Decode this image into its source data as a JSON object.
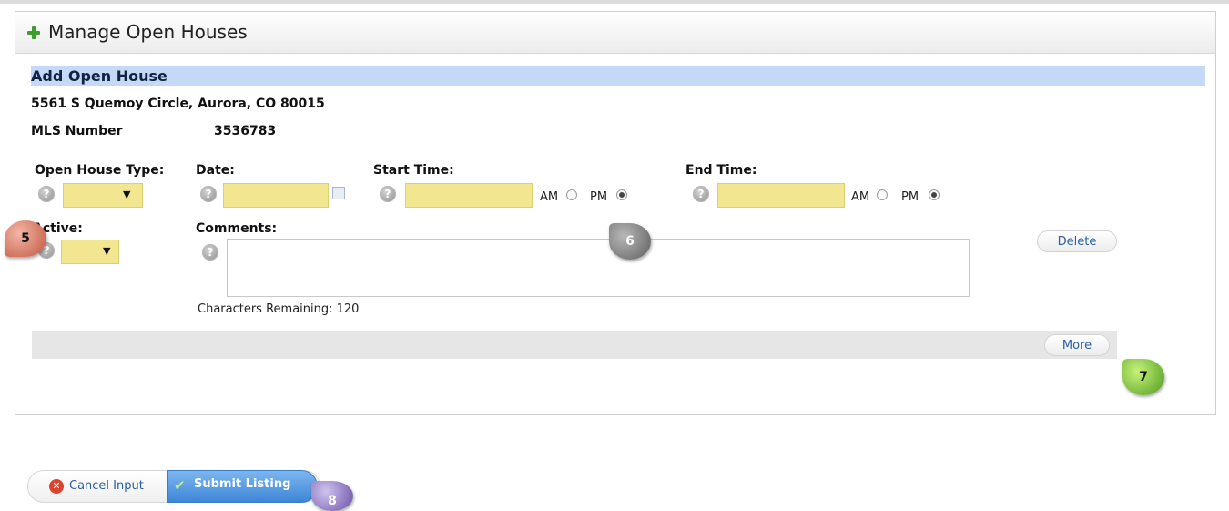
{
  "header": {
    "title": "Manage Open Houses",
    "icon": "plus-icon"
  },
  "section": {
    "title": "Add Open House"
  },
  "listing": {
    "address": "5561 S Quemoy Circle, Aurora, CO 80015",
    "mls_label": "MLS Number",
    "mls_value": "3536783"
  },
  "form": {
    "open_house_type_label": "Open House Type:",
    "date_label": "Date:",
    "start_time_label": "Start Time:",
    "end_time_label": "End Time:",
    "active_label": "Active:",
    "comments_label": "Comments:",
    "am_label": "AM",
    "pm_label": "PM",
    "start_pm_selected": true,
    "end_pm_selected": true,
    "help_glyph": "?",
    "select_arrow": "▼",
    "characters_remaining_label": "Characters Remaining:",
    "characters_remaining": "120"
  },
  "buttons": {
    "delete": "Delete",
    "more": "More",
    "cancel": "Cancel Input",
    "cancel_glyph": "✕",
    "submit": "Submit Listing",
    "submit_glyph": "✔"
  },
  "badges": {
    "b5": "5",
    "b6": "6",
    "b7": "7",
    "b8": "8"
  },
  "colors": {
    "field_yellow": "#f3e691",
    "section_blue": "#c4d9f5",
    "accent_blue": "#3d86d6"
  }
}
